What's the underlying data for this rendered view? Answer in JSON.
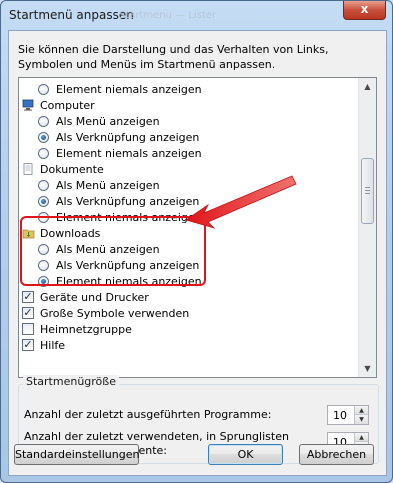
{
  "window": {
    "title": "Startmenü anpassen",
    "ghost_title": "Startmenu — Lister",
    "close_label": "x"
  },
  "description": "Sie können die Darstellung und das Verhalten von Links, Symbolen und Menüs im Startmenü anpassen.",
  "list": {
    "items": [
      {
        "type": "radio",
        "label": "Element niemals anzeigen",
        "checked": false
      },
      {
        "type": "group",
        "label": "Computer",
        "icon": "computer-icon"
      },
      {
        "type": "radio",
        "label": "Als Menü anzeigen",
        "checked": false
      },
      {
        "type": "radio",
        "label": "Als Verknüpfung anzeigen",
        "checked": true
      },
      {
        "type": "radio",
        "label": "Element niemals anzeigen",
        "checked": false
      },
      {
        "type": "group",
        "label": "Dokumente",
        "icon": "documents-icon"
      },
      {
        "type": "radio",
        "label": "Als Menü anzeigen",
        "checked": false
      },
      {
        "type": "radio",
        "label": "Als Verknüpfung anzeigen",
        "checked": true
      },
      {
        "type": "radio",
        "label": "Element niemals anzeigen",
        "checked": false
      },
      {
        "type": "group",
        "label": "Downloads",
        "icon": "downloads-icon"
      },
      {
        "type": "radio",
        "label": "Als Menü anzeigen",
        "checked": false
      },
      {
        "type": "radio",
        "label": "Als Verknüpfung anzeigen",
        "checked": false
      },
      {
        "type": "radio",
        "label": "Element niemals anzeigen",
        "checked": true
      },
      {
        "type": "check",
        "label": "Geräte und Drucker",
        "checked": true
      },
      {
        "type": "check",
        "label": "Große Symbole verwenden",
        "checked": true
      },
      {
        "type": "check",
        "label": "Heimnetzgruppe",
        "checked": false
      },
      {
        "type": "check",
        "label": "Hilfe",
        "checked": true
      }
    ]
  },
  "size_group": {
    "legend": "Startmenügröße",
    "recent_programs_label": "Anzahl der zuletzt ausgeführten Programme:",
    "recent_programs_value": "10",
    "jumplist_label": "Anzahl der zuletzt verwendeten, in Sprunglisten anzuzeigenden Elemente:",
    "jumplist_value": "10"
  },
  "buttons": {
    "defaults": "Standardeinstellungen",
    "ok": "OK",
    "cancel": "Abbrechen"
  },
  "colors": {
    "highlight": "#e0151b"
  }
}
